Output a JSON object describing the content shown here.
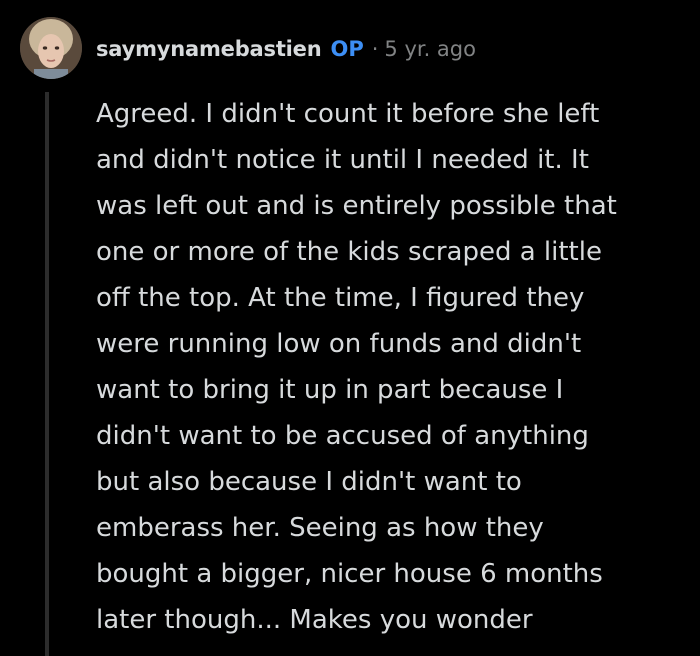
{
  "comment": {
    "author": "saymynamebastien",
    "badge": "OP",
    "separator": "·",
    "timestamp": "5 yr. ago",
    "lines": [
      "Agreed. I didn't count it before she left",
      "and didn't notice it until I needed it. It",
      "was left out and is entirely possible that",
      "one or more of the kids scraped a little",
      "off the top. At the time, I figured they",
      "were running low on funds and didn't",
      "want to bring it up in part because I",
      "didn't want to be accused of anything",
      "but also because I didn't want to",
      "emberass her. Seeing as how they",
      "bought a bigger, nicer house 6 months",
      "later though... Makes you wonder"
    ]
  },
  "colors": {
    "background": "#000000",
    "text": "#d7dadc",
    "op_badge": "#3d8ff5",
    "muted": "#818384",
    "thread_line": "#2c2c2c"
  },
  "icons": {
    "avatar": "user-avatar-photo"
  }
}
